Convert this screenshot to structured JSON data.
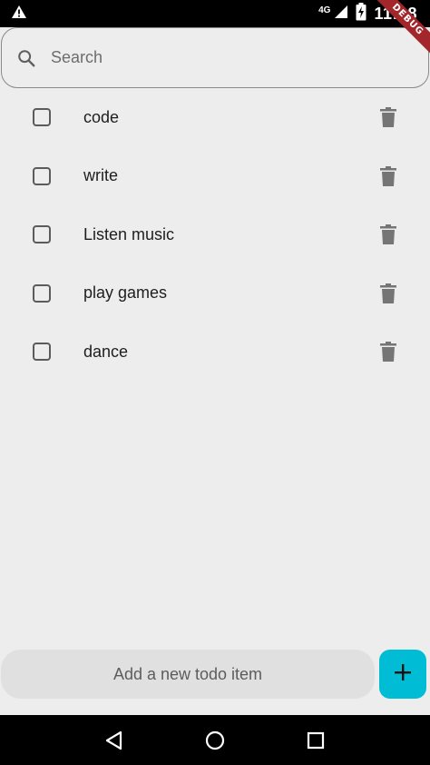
{
  "status_bar": {
    "time": "11:18",
    "network": "4G",
    "alert_icon": "warning-icon",
    "battery_icon": "battery-charging-icon",
    "signal_icon": "signal-icon"
  },
  "debug_banner": {
    "label": "DEBUG",
    "color": "#a3262a"
  },
  "search": {
    "placeholder": "Search",
    "icon": "search-icon"
  },
  "todos": [
    {
      "label": "code",
      "checked": false
    },
    {
      "label": "write",
      "checked": false
    },
    {
      "label": "Listen music",
      "checked": false
    },
    {
      "label": "play games",
      "checked": false
    },
    {
      "label": "dance",
      "checked": false
    }
  ],
  "add_todo": {
    "placeholder": "Add a new todo item",
    "button_icon": "plus-icon",
    "button_color": "#00bcd4"
  },
  "nav": {
    "back_icon": "back-icon",
    "home_icon": "home-icon",
    "recents_icon": "recents-icon"
  }
}
